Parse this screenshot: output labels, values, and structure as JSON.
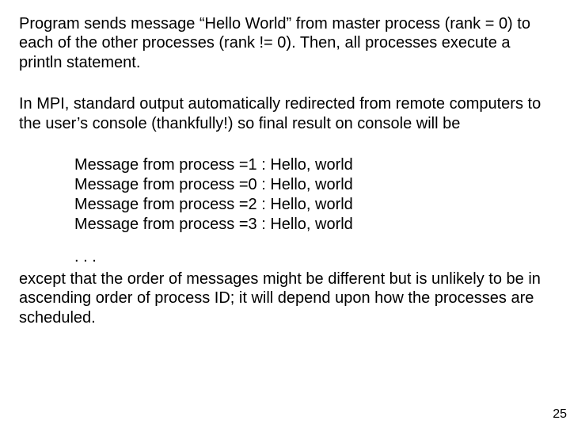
{
  "para1": "Program sends message “Hello World” from master process (rank = 0) to each of the other processes (rank != 0). Then, all processes execute a println statement.",
  "para2": "In MPI, standard output automatically redirected from remote computers to the user’s console (thankfully!) so final result on console will be",
  "output": {
    "line1": "Message from process =1 : Hello, world",
    "line2": "Message from process =0 : Hello, world",
    "line3": "Message from process =2 : Hello, world",
    "line4": "Message from process =3 : Hello, world"
  },
  "ellipsis": ". . .",
  "para3": "except that the order of messages might be different but is unlikely to be in ascending order of process ID; it will depend upon how the processes are scheduled.",
  "page_number": "25"
}
